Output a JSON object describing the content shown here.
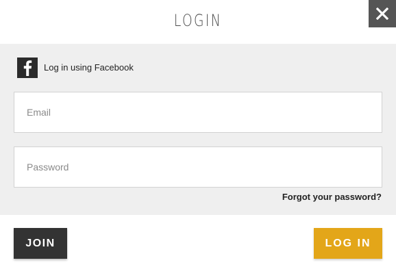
{
  "modal": {
    "title": "LOGIN",
    "close_icon": "close-icon"
  },
  "facebook": {
    "icon": "facebook-icon",
    "label": "Log in using Facebook"
  },
  "form": {
    "email_placeholder": "Email",
    "email_value": "",
    "password_placeholder": "Password",
    "password_value": "",
    "forgot_label": "Forgot your password?"
  },
  "actions": {
    "join_label": "JOIN",
    "login_label": "LOG IN"
  },
  "colors": {
    "accent": "#e3a619",
    "dark_button": "#333333",
    "close_bg": "#555555",
    "panel_bg": "#efefef"
  }
}
